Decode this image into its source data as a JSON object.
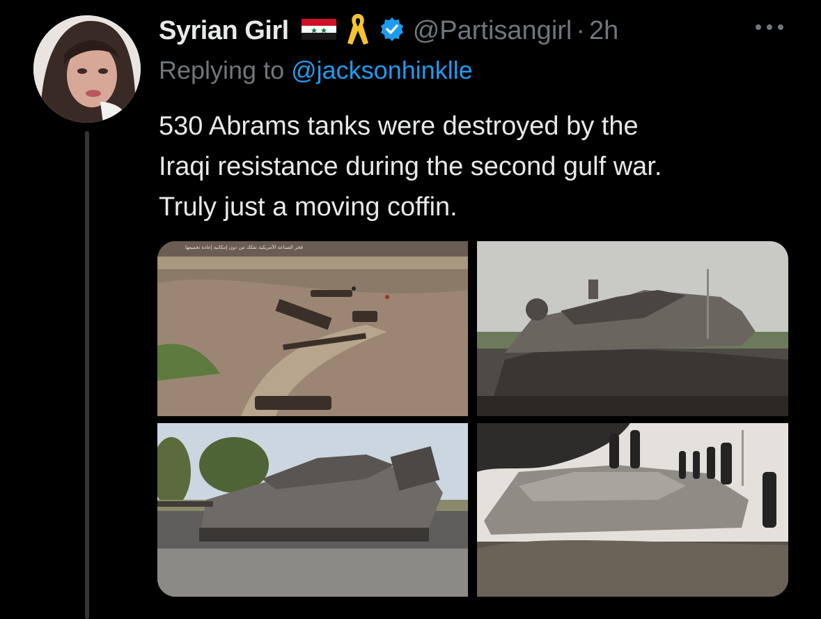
{
  "tweet": {
    "author_name": "Syrian Girl",
    "handle": "@Partisangirl",
    "separator": "·",
    "time": "2h",
    "replying_prefix": "Replying to ",
    "replying_to": "@jacksonhinklle",
    "text_lines": [
      "530 Abrams tanks were destroyed by the",
      "Iraqi resistance during the second gulf war.",
      "Truly just a moving coffin."
    ],
    "photo_1_caption": "فخر الصناعة الأمريكية تفكك من دون إمكانية إعادة تجميعها"
  },
  "icons": {
    "flag": "syria-flag-icon",
    "ribbon": "yellow-ribbon-icon",
    "verified": "verified-badge-icon",
    "more": "more-options-icon"
  },
  "colors": {
    "background": "#000000",
    "text_primary": "#e7e9ea",
    "text_secondary": "#71767b",
    "accent": "#1d9bf0",
    "ribbon": "#f4c430"
  }
}
